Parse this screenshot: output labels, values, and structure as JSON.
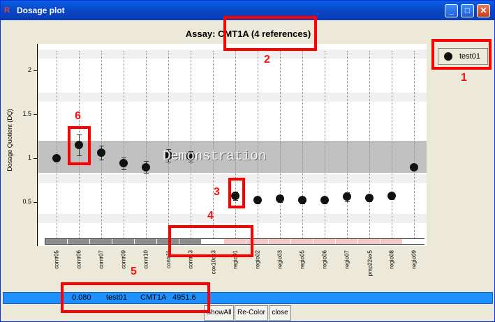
{
  "window": {
    "title": "Dosage plot",
    "app_icon": "R",
    "minimize_icon": "minimize-icon",
    "maximize_icon": "maximize-icon",
    "close_icon": "close-icon"
  },
  "legend": {
    "label": "test01"
  },
  "status": {
    "value": "0.080",
    "sample": "test01",
    "assay": "CMT1A",
    "number": "4951.6"
  },
  "buttons": {
    "show_all": "ShowAll",
    "recolor": "Re-Color",
    "close": "close"
  },
  "annotations": [
    "1",
    "2",
    "3",
    "4",
    "5",
    "6"
  ],
  "watermark": "Demonstration",
  "colors": {
    "status_bar": "#1e90ff",
    "demo_band": "#c0c0c0",
    "control_segment": "#8c8c8c",
    "region_segment": "#f5c6c8",
    "annotation": "#ff0000"
  },
  "chart_data": {
    "type": "scatter",
    "title": "Assay: CMT1A (4 references)",
    "xlabel": "",
    "ylabel": "Dosage Quotient (DQ)",
    "ylim": [
      0.0,
      2.3
    ],
    "yticks": [
      "0.5",
      "1",
      "1.5",
      "2"
    ],
    "grid": true,
    "legend_position": "outside-top-right",
    "categories": [
      "contr05",
      "contr06",
      "contr07",
      "contr09",
      "contr10",
      "contr11",
      "contr13",
      "cox10ex3",
      "regio01",
      "regio02",
      "regio03",
      "regio05",
      "regio06",
      "regio07",
      "pmp22ex5",
      "regio08",
      "regio09"
    ],
    "category_groups": [
      "control",
      "control",
      "control",
      "control",
      "control",
      "control",
      "control",
      "other",
      "region",
      "region",
      "region",
      "region",
      "region",
      "region",
      "region",
      "region",
      "other"
    ],
    "series": [
      {
        "name": "test01",
        "values": [
          1.0,
          1.15,
          1.06,
          0.94,
          0.9,
          1.03,
          1.02,
          null,
          0.57,
          0.52,
          0.54,
          0.52,
          0.52,
          0.56,
          0.55,
          0.57,
          0.9
        ],
        "errors": [
          0.03,
          0.12,
          0.08,
          0.07,
          0.07,
          0.07,
          0.06,
          null,
          0.05,
          0.04,
          0.04,
          0.04,
          0.04,
          0.05,
          0.04,
          0.04,
          0.03
        ]
      }
    ]
  }
}
